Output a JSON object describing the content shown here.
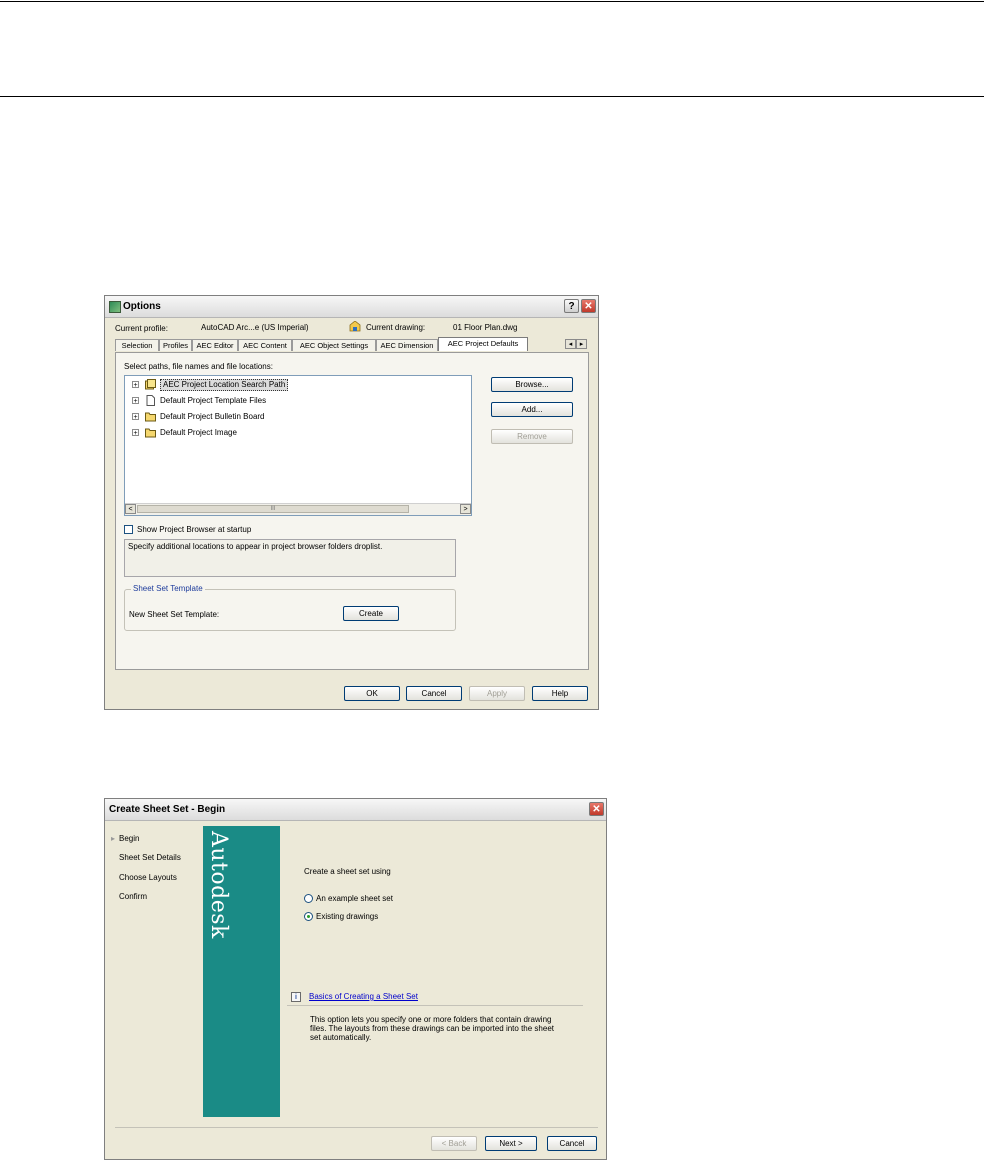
{
  "options_dialog": {
    "title": "Options",
    "help_glyph": "?",
    "close_glyph": "✕",
    "current_profile_label": "Current profile:",
    "current_profile_value": "AutoCAD Arc...e (US Imperial)",
    "current_drawing_label": "Current drawing:",
    "current_drawing_value": "01 Floor Plan.dwg",
    "tabs": [
      "Selection",
      "Profiles",
      "AEC Editor",
      "AEC Content",
      "AEC Object Settings",
      "AEC Dimension",
      "AEC Project Defaults"
    ],
    "tab_scroll_left": "◂",
    "tab_scroll_right": "▸",
    "select_label": "Select paths, file names and file locations:",
    "tree_items": [
      {
        "label": "AEC Project Location Search Path",
        "expander": "+"
      },
      {
        "label": "Default Project Template Files",
        "expander": "+"
      },
      {
        "label": "Default Project Bulletin Board",
        "expander": "+"
      },
      {
        "label": "Default Project Image",
        "expander": "+"
      }
    ],
    "scroll_left_glyph": "<",
    "scroll_right_glyph": ">",
    "scroll_thumb_glyph": "III",
    "browse_button": "Browse...",
    "add_button": "Add...",
    "remove_button": "Remove",
    "show_browser_label": "Show Project Browser at startup",
    "description": "Specify additional locations to appear in project browser folders droplist.",
    "sheet_set_group_label": "Sheet Set Template",
    "new_template_label": "New Sheet Set Template:",
    "create_button": "Create",
    "ok_button": "OK",
    "cancel_button": "Cancel",
    "apply_button": "Apply",
    "help_button": "Help"
  },
  "sheet_set_dialog": {
    "title": "Create Sheet Set - Begin",
    "close_glyph": "✕",
    "steps": [
      "Begin",
      "Sheet Set Details",
      "Choose Layouts",
      "Confirm"
    ],
    "current_step_marker": "▸",
    "brand": "Autodesk",
    "prompt": "Create a sheet set using",
    "options": [
      {
        "label": "An example sheet set",
        "selected": false
      },
      {
        "label": "Existing drawings",
        "selected": true
      }
    ],
    "info_glyph": "i",
    "help_link": "Basics of Creating a Sheet Set",
    "explanation": "This option lets you specify one or more folders that contain drawing files.  The layouts from these drawings can be imported into the sheet set automatically.",
    "back_button": "< Back",
    "next_button": "Next >",
    "cancel_button": "Cancel"
  }
}
